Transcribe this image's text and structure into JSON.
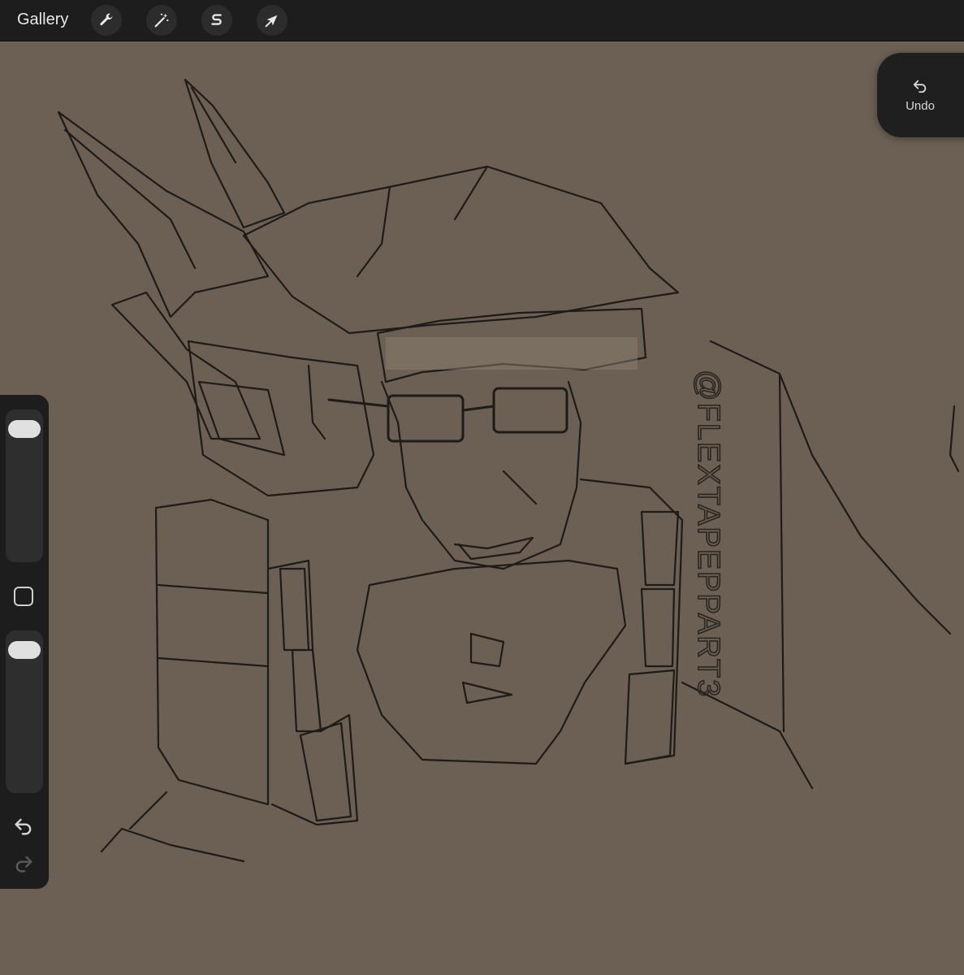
{
  "toolbar": {
    "gallery_label": "Gallery",
    "tools": [
      {
        "name": "actions",
        "icon": "wrench-icon"
      },
      {
        "name": "adjustments",
        "icon": "magic-wand-icon"
      },
      {
        "name": "selection",
        "icon": "selection-s-icon"
      },
      {
        "name": "transform",
        "icon": "arrow-cursor-icon"
      }
    ]
  },
  "undo_button": {
    "label": "Undo",
    "icon": "undo-arrow-icon"
  },
  "sidebar": {
    "brush_size": 0.95,
    "opacity": 0.95,
    "modify_button_icon": "square-icon",
    "undo_icon": "undo-arrow-icon",
    "redo_icon": "redo-arrow-icon"
  },
  "canvas": {
    "background_color": "#6b6053",
    "signature_text": "@FLEXTAPEPPART3"
  }
}
